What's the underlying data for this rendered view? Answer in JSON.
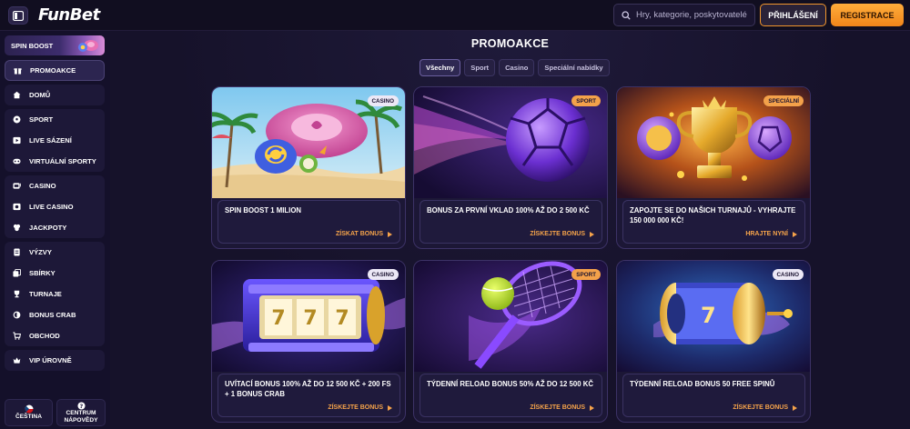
{
  "header": {
    "logo": "FunBet",
    "search_placeholder": "Hry, kategorie, poskytovatelé",
    "login_label": "PŘIHLÁŠENÍ",
    "register_label": "REGISTRACE"
  },
  "sidebar": {
    "spin_boost_label": "SPIN BOOST",
    "groups": [
      [
        {
          "label": "PROMOAKCE",
          "icon": "gift-icon",
          "active": true
        }
      ],
      [
        {
          "label": "DOMŮ",
          "icon": "home-icon"
        }
      ],
      [
        {
          "label": "SPORT",
          "icon": "soccer-ball-icon"
        },
        {
          "label": "LIVE SÁZENÍ",
          "icon": "play-icon"
        },
        {
          "label": "VIRTUÁLNÍ SPORTY",
          "icon": "virtual-sports-icon"
        }
      ],
      [
        {
          "label": "CASINO",
          "icon": "slot-icon"
        },
        {
          "label": "LIVE CASINO",
          "icon": "live-casino-icon"
        },
        {
          "label": "JACKPOTY",
          "icon": "jackpot-icon"
        }
      ],
      [
        {
          "label": "VÝZVY",
          "icon": "challenge-icon"
        },
        {
          "label": "SBÍRKY",
          "icon": "collection-icon"
        },
        {
          "label": "TURNAJE",
          "icon": "trophy-icon"
        },
        {
          "label": "BONUS CRAB",
          "icon": "crab-icon"
        },
        {
          "label": "OBCHOD",
          "icon": "shop-icon"
        }
      ],
      [
        {
          "label": "VIP ÚROVNĚ",
          "icon": "crown-icon"
        }
      ]
    ],
    "language_label": "ČEŠTINA",
    "help_label_1": "CENTRUM",
    "help_label_2": "NÁPOVĚDY"
  },
  "main": {
    "title": "PROMOAKCE",
    "filters": [
      "Všechny",
      "Sport",
      "Casino",
      "Speciální nabídky"
    ],
    "active_filter": "Všechny",
    "cards": [
      {
        "badge": "CASINO",
        "title": "SPIN BOOST 1 MILION",
        "cta": "ZÍSKAT BONUS"
      },
      {
        "badge": "SPORT",
        "title": "BONUS ZA PRVNÍ VKLAD 100% AŽ DO 2 500 KČ",
        "cta": "ZÍSKEJTE BONUS"
      },
      {
        "badge": "SPECIÁLNÍ",
        "title": "ZAPOJTE SE DO NAŠICH TURNAJŮ - VYHRAJTE 150 000 000 KČ!",
        "cta": "HRAJTE NYNÍ"
      },
      {
        "badge": "CASINO",
        "title": "UVÍTACÍ BONUS 100% AŽ DO 12 500 KČ + 200 FS + 1 BONUS CRAB",
        "cta": "ZÍSKEJTE BONUS"
      },
      {
        "badge": "SPORT",
        "title": "TÝDENNÍ RELOAD BONUS 50% AŽ DO 12 500 KČ",
        "cta": "ZÍSKEJTE BONUS"
      },
      {
        "badge": "CASINO",
        "title": "TÝDENNÍ RELOAD BONUS 50 FREE SPINŮ",
        "cta": "ZÍSKEJTE BONUS"
      }
    ]
  },
  "colors": {
    "accent_orange": "#f5a34a",
    "background": "#16122a",
    "panel": "#1d1838"
  }
}
